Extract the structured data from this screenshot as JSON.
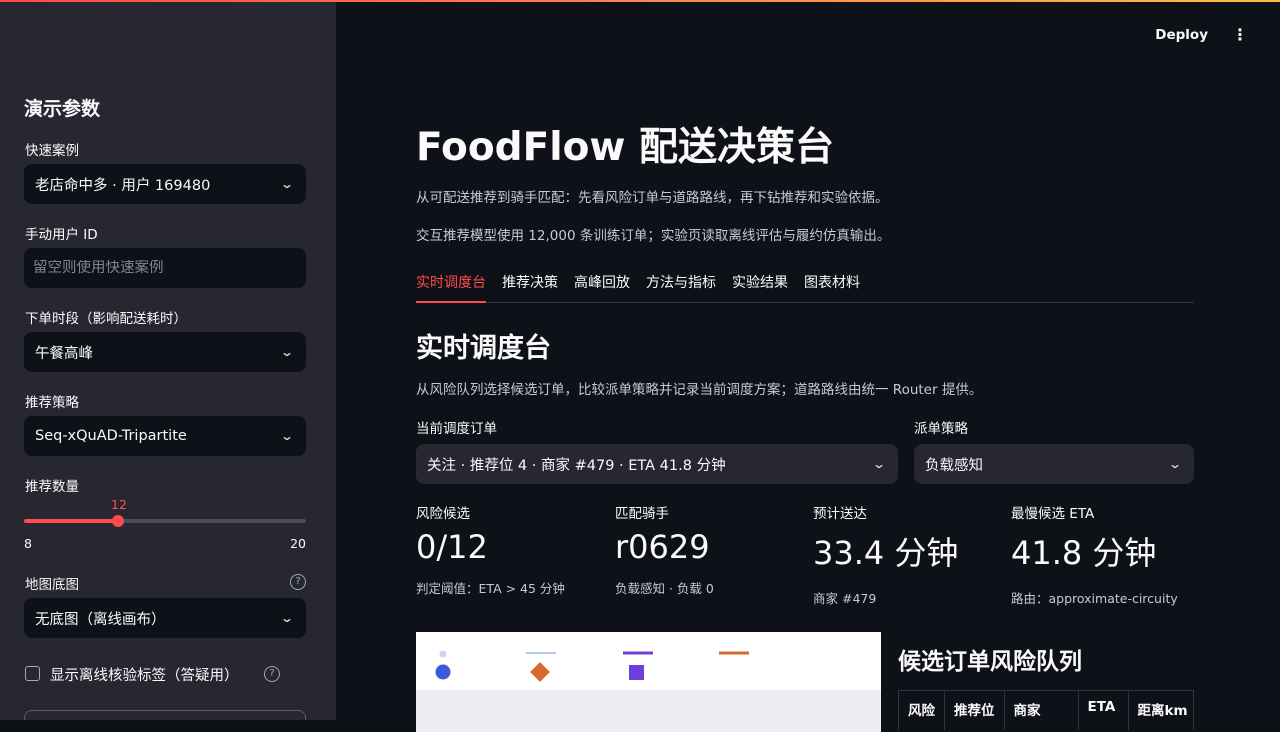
{
  "sidebar": {
    "title": "演示参数",
    "quick_case": {
      "label": "快速案例",
      "value": "老店命中多 · 用户 169480"
    },
    "manual_user": {
      "label": "手动用户 ID",
      "placeholder": "留空则使用快速案例"
    },
    "order_period": {
      "label": "下单时段（影响配送耗时）",
      "value": "午餐高峰"
    },
    "strategy": {
      "label": "推荐策略",
      "value": "Seq-xQuAD-Tripartite"
    },
    "count": {
      "label": "推荐数量",
      "value": 12,
      "value_text": "12",
      "min": 8,
      "max": 20,
      "min_text": "8",
      "max_text": "20"
    },
    "basemap": {
      "label": "地图底图",
      "value": "无底图（离线画布）",
      "help": "?"
    },
    "offline_label": {
      "label": "显示离线核验标签（答疑用）",
      "help": "?"
    }
  },
  "header": {
    "deploy": "Deploy",
    "menu": "⋮"
  },
  "main": {
    "title": "FoodFlow 配送决策台",
    "intro1": "从可配送推荐到骑手匹配：先看风险订单与道路路线，再下钻推荐和实验依据。",
    "intro2": "交互推荐模型使用 12,000 条训练订单；实验页读取离线评估与履约仿真输出。",
    "tabs": [
      {
        "label": "实时调度台"
      },
      {
        "label": "推荐决策"
      },
      {
        "label": "高峰回放"
      },
      {
        "label": "方法与指标"
      },
      {
        "label": "实验结果"
      },
      {
        "label": "图表材料"
      }
    ],
    "section_title": "实时调度台",
    "section_desc": "从风险队列选择候选订单，比较派单策略并记录当前调度方案；道路路线由统一 Router 提供。",
    "current_order": {
      "label": "当前调度订单",
      "value": "关注 · 推荐位 4 · 商家 #479 · ETA 41.8 分钟"
    },
    "dispatch_strategy": {
      "label": "派单策略",
      "value": "负载感知"
    },
    "metrics": [
      {
        "label": "风险候选",
        "value": "0/12",
        "sub": "判定阈值：ETA > 45 分钟"
      },
      {
        "label": "匹配骑手",
        "value": "r0629",
        "sub": "负载感知 · 负载 0"
      },
      {
        "label": "预计送达",
        "value": "33.4 分钟",
        "sub": "商家 #479"
      },
      {
        "label": "最慢候选 ETA",
        "value": "41.8 分钟",
        "sub": "路由：approximate-circuity"
      }
    ],
    "risk_queue": {
      "title": "候选订单风险队列",
      "columns": [
        "风险",
        "推荐位",
        "商家",
        "ETA",
        "距离km"
      ]
    }
  },
  "colors": {
    "accent": "#ff4b4b",
    "background": "#0e1117",
    "sidebar": "#262730"
  }
}
